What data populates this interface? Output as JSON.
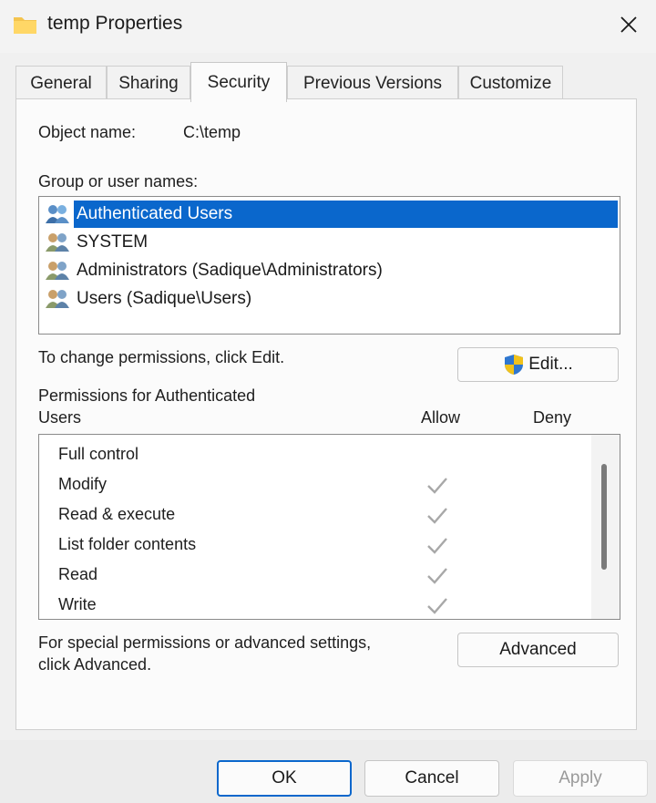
{
  "window": {
    "title": "temp Properties"
  },
  "tabs": [
    {
      "label": "General"
    },
    {
      "label": "Sharing"
    },
    {
      "label": "Security"
    },
    {
      "label": "Previous Versions"
    },
    {
      "label": "Customize"
    }
  ],
  "object": {
    "label": "Object name:",
    "value": "C:\\temp"
  },
  "groups": {
    "label": "Group or user names:",
    "items": [
      {
        "name": "Authenticated Users"
      },
      {
        "name": "SYSTEM"
      },
      {
        "name": "Administrators (Sadique\\Administrators)"
      },
      {
        "name": "Users (Sadique\\Users)"
      }
    ]
  },
  "change": {
    "text": "To change permissions, click Edit.",
    "edit_label": "Edit..."
  },
  "permissions": {
    "title_line1": "Permissions for Authenticated",
    "title_line2": "Users",
    "allow_label": "Allow",
    "deny_label": "Deny",
    "rows": [
      {
        "name": "Full control",
        "allow": false,
        "deny": false
      },
      {
        "name": "Modify",
        "allow": true,
        "deny": false
      },
      {
        "name": "Read & execute",
        "allow": true,
        "deny": false
      },
      {
        "name": "List folder contents",
        "allow": true,
        "deny": false
      },
      {
        "name": "Read",
        "allow": true,
        "deny": false
      },
      {
        "name": "Write",
        "allow": true,
        "deny": false
      }
    ]
  },
  "special": {
    "line1": "For special permissions or advanced settings,",
    "line2": "click Advanced.",
    "advanced_label": "Advanced"
  },
  "footer": {
    "ok_label": "OK",
    "cancel_label": "Cancel",
    "apply_label": "Apply"
  },
  "colors": {
    "selection": "#0a67cc",
    "check": "#a8a8a8"
  }
}
